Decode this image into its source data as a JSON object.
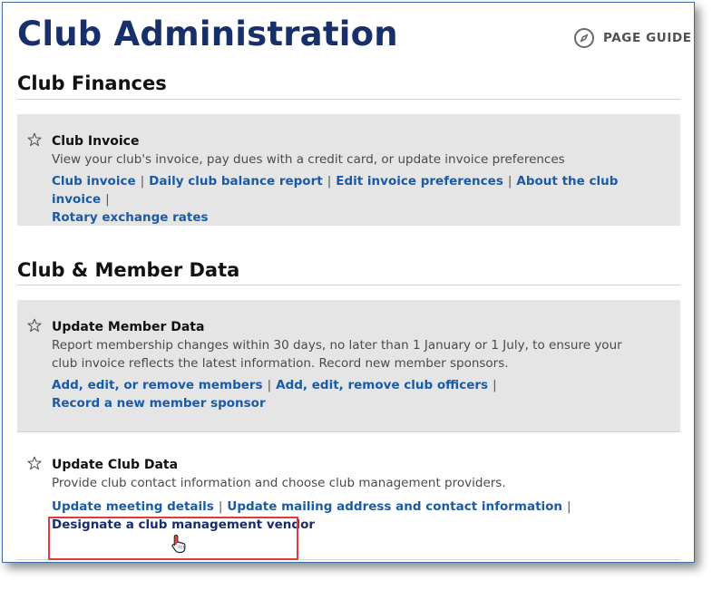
{
  "page": {
    "title": "Club Administration",
    "page_guide_label": "PAGE GUIDE",
    "page_guide_icon": "compass-icon"
  },
  "sections": [
    {
      "title": "Club Finances",
      "items": [
        {
          "title": "Club Invoice",
          "description": "View your club's invoice, pay dues with a credit card, or update invoice preferences",
          "links": [
            "Club invoice",
            "Daily club balance report",
            "Edit invoice preferences",
            "About the club invoice",
            "Rotary exchange rates"
          ]
        }
      ]
    },
    {
      "title": "Club & Member Data",
      "items": [
        {
          "title": "Update Member Data",
          "description": "Report membership changes within 30 days, no later than 1 January or 1 July, to ensure your club invoice reflects the latest information. Record new member sponsors.",
          "links": [
            "Add, edit, or remove members",
            "Add, edit, remove club officers",
            "Record a new member sponsor"
          ]
        },
        {
          "title": "Update Club Data",
          "description": "Provide club contact information and choose club management providers.",
          "links": [
            "Update meeting details",
            "Update mailing address and contact information",
            "Designate a club management vendor"
          ]
        }
      ]
    }
  ],
  "separator": "|",
  "colors": {
    "title": "#17306b",
    "link": "#1b5ba6",
    "card_background": "#e5e5e5",
    "highlight": "#e03a3a"
  }
}
